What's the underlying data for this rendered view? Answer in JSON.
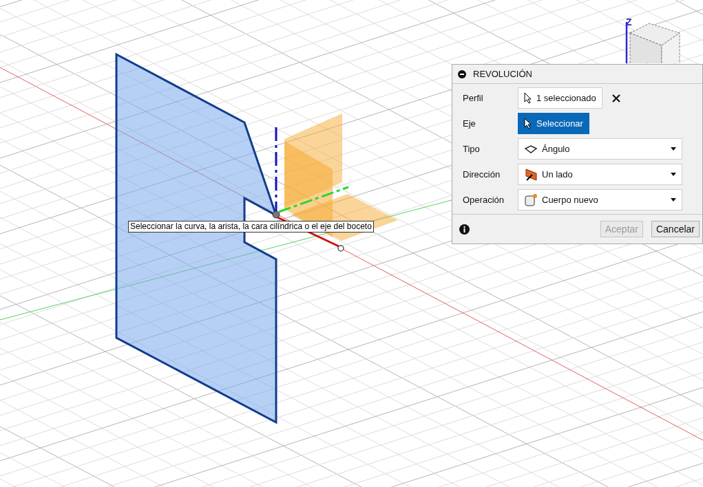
{
  "viewport": {
    "axis_label": "Z",
    "tooltip": "Seleccionar la curva, la arista, la cara cilíndrica o el eje del boceto"
  },
  "dialog": {
    "title": "REVOLUCIÓN",
    "rows": [
      {
        "kind": "selection",
        "label": "Perfil",
        "value": "1 seleccionado"
      },
      {
        "kind": "select-button",
        "label": "Eje",
        "value": "Seleccionar",
        "active": true
      },
      {
        "kind": "dropdown",
        "label": "Tipo",
        "value": "Ángulo"
      },
      {
        "kind": "dropdown",
        "label": "Dirección",
        "value": "Un lado"
      },
      {
        "kind": "dropdown",
        "label": "Operación",
        "value": "Cuerpo nuevo"
      }
    ],
    "buttons": [
      {
        "label": "Aceptar",
        "disabled": true
      },
      {
        "label": "Cancelar",
        "disabled": false
      }
    ]
  }
}
